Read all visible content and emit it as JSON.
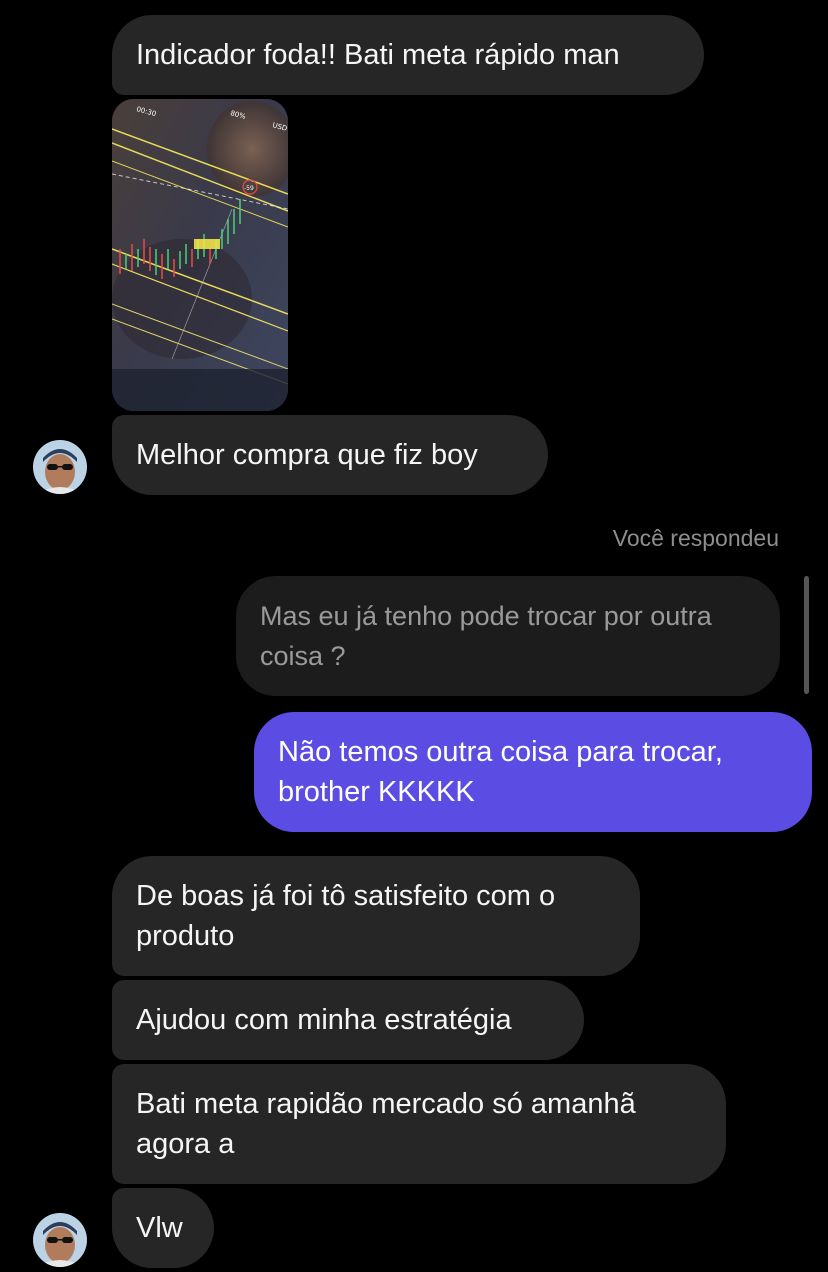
{
  "messages": {
    "m1": "Indicador foda!! Bati meta rápido man",
    "m2": "Melhor compra que fiz boy",
    "reply_label": "Você respondeu",
    "replied_quote": "Mas eu já tenho pode trocar por outra\ncoisa ?",
    "outgoing": "Não temos outra coisa para trocar,\nbrother KKKKK",
    "m3": "De boas já foi tô satisfeito com o\nproduto",
    "m4": "Ajudou com minha estratégia",
    "m5": "Bati meta rapidão mercado só amanhã\nagora a",
    "m6": "Vlw"
  },
  "photo": {
    "status_time": "00:30",
    "battery": "80%",
    "currency": "USD",
    "price_marker": "-59"
  },
  "colors": {
    "background": "#000000",
    "incoming_bubble": "#262626",
    "outgoing_bubble": "#5b4de3",
    "replied_bubble": "#1c1c1c",
    "chart_lines": "#e7d95a"
  }
}
